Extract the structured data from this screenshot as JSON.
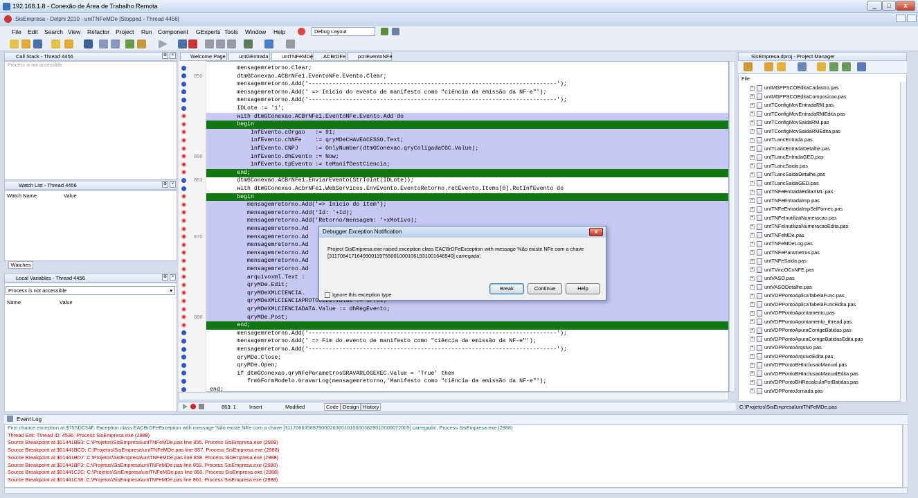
{
  "rdp": {
    "title": "192.168.1.8 - Conexão de Área de Trabalho Remota",
    "min": "_",
    "max": "□",
    "close": "x"
  },
  "app": {
    "title": "SisEmpresa - Delphi 2010 - untTNFeMDe [Stopped - Thread 4456]"
  },
  "menu": [
    "File",
    "Edit",
    "Search",
    "View",
    "Refactor",
    "Project",
    "Run",
    "Component",
    "GExperts",
    "Tools",
    "Window",
    "Help"
  ],
  "toolbar": {
    "layout": "Debug Layout"
  },
  "callstack": {
    "title": "Call Stack - Thread 4456",
    "message": "Process is not accessible"
  },
  "watch": {
    "title": "Watch List - Thread 4456",
    "col_name": "Watch Name",
    "col_value": "Value",
    "tab": "Watches"
  },
  "locals": {
    "title": "Local Variables - Thread 4456",
    "combo": "Process is not accessible",
    "col_name": "Name",
    "col_value": "Value"
  },
  "tabs": [
    "Welcome Page",
    "untGEntrada",
    "untTNFeMDe",
    "ACBrDFe",
    "pcnEventoNFe"
  ],
  "code": [
    {
      "t": "        mensagemretorno.Clear;",
      "h": ""
    },
    {
      "t": "        dtmGConexao.ACBrNFe1.EventoNFe.Evento.Clear;",
      "h": "",
      "n": "850"
    },
    {
      "t": "        mensagemretorno.Add('-------------------------------------------------------------------------');",
      "h": ""
    },
    {
      "t": "        mensagemretorno.Add(' => Inicio do evento de manifesto como \"ciência da emissão da NF-e\"');",
      "h": ""
    },
    {
      "t": "        mensagemretorno.Add('-------------------------------------------------------------------------');",
      "h": ""
    },
    {
      "t": "        IDLote := '1';",
      "h": ""
    },
    {
      "t": "        with dtmGConexao.ACBrNFe1.EventoNFe.Evento.Add do",
      "h": "hl"
    },
    {
      "t": "        begin",
      "h": "bp"
    },
    {
      "t": "            InfEvento.cOrgao   := 91;",
      "h": "hl"
    },
    {
      "t": "            infEvento.chNFe    := qryMDeCHAVEACESSO.Text;",
      "h": "hl"
    },
    {
      "t": "            infEvento.CNPJ     := OnlyNumber(dtmGConexao.qryColigadaCGC.Value);",
      "h": "hl"
    },
    {
      "t": "            infEvento.dhEvento := Now;",
      "h": "hl",
      "n": "860"
    },
    {
      "t": "            infEvento.tpEvento := teManifDestCiencia;",
      "h": "hl"
    },
    {
      "t": "        end;",
      "h": "bp"
    },
    {
      "t": "        dtmGConexao.ACBrNFe1.EnviarEvento(StrToInt(IDLote));",
      "h": "",
      "n": "863"
    },
    {
      "t": "        with dtmGConexao.AcbrNFe1.WebServices.EnvEvento.EventoRetorno.retEvento.Items[0].RetInfEvento do",
      "h": ""
    },
    {
      "t": "        begin",
      "h": "bp"
    },
    {
      "t": "           mensagemretorno.Add('=> Inicio do item');",
      "h": "hl"
    },
    {
      "t": "           mensagemretorno.Add('Id: '+Id);",
      "h": "hl"
    },
    {
      "t": "           mensagemretorno.Add('Retorno/mensagem: '+xMotivo);",
      "h": "hl"
    },
    {
      "t": "           mensagemretorno.Ad",
      "h": "hl"
    },
    {
      "t": "           mensagemretorno.Ad",
      "h": "hl",
      "n": "870"
    },
    {
      "t": "           mensagemretorno.Ad",
      "h": "hl"
    },
    {
      "t": "           mensagemretorno.Ad",
      "h": "hl"
    },
    {
      "t": "           mensagemretorno.Ad",
      "h": "hl"
    },
    {
      "t": "           mensagemretorno.Ad",
      "h": "hl"
    },
    {
      "t": "           arquivoxml.Text :",
      "h": "hl"
    },
    {
      "t": "           qryMDe.Edit;",
      "h": "hl"
    },
    {
      "t": "           qryMDeXMLCIENCIA.",
      "h": "hl"
    },
    {
      "t": "           qryMDeXMLCIENCIAPROTOCOLO.Value := nProt;",
      "h": "hl"
    },
    {
      "t": "           qryMDeXMLCIENCIADATA.Value := dhRegEvento;",
      "h": "hl"
    },
    {
      "t": "           qryMDe.Post;",
      "h": "hl",
      "n": "880"
    },
    {
      "t": "        end;",
      "h": "bp"
    },
    {
      "t": "        mensagemretorno.Add('-------------------------------------------------------------------------');",
      "h": ""
    },
    {
      "t": "        mensagemretorno.Add(' => Fim do evento de manifesto como \"ciência da emissão da NF-e\"');",
      "h": ""
    },
    {
      "t": "        mensagemretorno.Add('-------------------------------------------------------------------------');",
      "h": ""
    },
    {
      "t": "        qryMDe.Close;",
      "h": ""
    },
    {
      "t": "        qryMDe.Open;",
      "h": ""
    },
    {
      "t": "        if dtmGConexao.qryNFeParametrosGRAVARLOGEXEC.Value = 'True' then",
      "h": ""
    },
    {
      "t": "           frmGFormModelo.GravarLog(mensagemretorno,'Manifesto como \"ciência da emissão da NF-e\"');",
      "h": ""
    },
    {
      "t": "end;",
      "h": ""
    }
  ],
  "status": {
    "pos": "863:  1",
    "mode": "Insert",
    "state": "Modified",
    "tabs": [
      "Code",
      "Design",
      "History"
    ]
  },
  "pm": {
    "title": "SisEmpresa.dproj - Project Manager",
    "file_label": "File",
    "path": "C:\\Projetos\\SisEmpresa\\untTNFeMDe.pas",
    "items": [
      "untMGPPSCOEditaCadastro.pas",
      "untMGPPSCOEditaComposicao.pas",
      "untTConfigMovEntradaRM.pas",
      "untTConfigMovEntradaRMEdita.pas",
      "untTConfigMovSaidaRM.pas",
      "untTConfigMovSaidaRMEdita.pas",
      "untTLancEntrada.pas",
      "untTLancEntradaDetalhe.pas",
      "untTLancEntradaGED.pas",
      "untTLancSaida.pas",
      "untTLancSaidaDetalhe.pas",
      "untTLancSaidaGED.pas",
      "untTNFeEntradaEditaXML.pas",
      "untTNFeEntradaImp.pas",
      "untTNFeEntradaImpSelFornec.pas",
      "untTNFeInutilizaNumeracao.pas",
      "untTNFeInutilizaNumeracaoEdita.pas",
      "untTNFeMDe.pas",
      "untTNFeMDeLog.pas",
      "untTNFeParametros.pas",
      "untTNFeSaida.pas",
      "untTVincOCxNFE.pas",
      "untVASO.pas",
      "untVASODetalhe.pas",
      "untVDPPontoAplicaTabelaFunc.pas",
      "untVDPPontoAplicaTabelaFuncEdita.pas",
      "untVDPPontoApontamento.pas",
      "untVDPPontoApontamento_thread.pas",
      "untVDPPontoApuraCorrigeBatidas.pas",
      "untVDPPontoApuraCorrigeBatidasEdita.pas",
      "untVDPPontoArquivo.pas",
      "untVDPPontoArquivoEdita.pas",
      "untVDPPontoBHInclusaoManual.pas",
      "untVDPPontoBHInclusaoManualEdita.pas",
      "untVDPPontoBHRecalculoPorBatidas.pas",
      "untVDPPontoJornada.pas"
    ]
  },
  "eventlog": {
    "title": "Event Log",
    "lines": [
      {
        "t": "First chance exception at $75SDC54F. Exception class EACBrDFeException with message 'Não existe NFe com a chave [31170663589790002636510100003829010000072005] carregada'. Process SisEmpresa.exe (2988)",
        "c": "teal"
      },
      {
        "t": "Thread Exit: Thread ID: 4536. Process SisEmpresa.exe (2988)",
        "c": "red"
      },
      {
        "t": "Source Breakpoint at $01441BB3: C:\\Projetos\\SisEmpresa\\untTNFeMDe.pas line 855. Process SisEmpresa.exe (2988)",
        "c": "red"
      },
      {
        "t": "Source Breakpoint at $01441BCD: C:\\Projetos\\SisEmpresa\\untTNFeMDe.pas line 857. Process SisEmpresa.exe (2988)",
        "c": "red"
      },
      {
        "t": "Source Breakpoint at $01441BD7: C:\\Projetos\\SisEmpresa\\untTNFeMDe.pas line 858. Process SisEmpresa.exe (2988)",
        "c": "red"
      },
      {
        "t": "Source Breakpoint at $01441BF3: C:\\Projetos\\SisEmpresa\\untTNFeMDe.pas line 859. Process SisEmpresa.exe (2988)",
        "c": "red"
      },
      {
        "t": "Source Breakpoint at $01441C2C: C:\\Projetos\\SisEmpresa\\untTNFeMDe.pas line 860. Process SisEmpresa.exe (2988)",
        "c": "red"
      },
      {
        "t": "Source Breakpoint at $01441C38: C:\\Projetos\\SisEmpresa\\untTNFeMDe.pas line 861. Process SisEmpresa.exe (2988)",
        "c": "red"
      }
    ]
  },
  "dialog": {
    "title": "Debugger Exception Notification",
    "message": "Project SisEmpresa.exe raised exception class EACBrDFeException with message 'Não existe NFe com a chave [31170641716499001197550010001061931001646540] carregada'.",
    "checkbox": "Ignore this exception type",
    "break": "Break",
    "continue": "Continue",
    "help": "Help",
    "close": "x"
  }
}
